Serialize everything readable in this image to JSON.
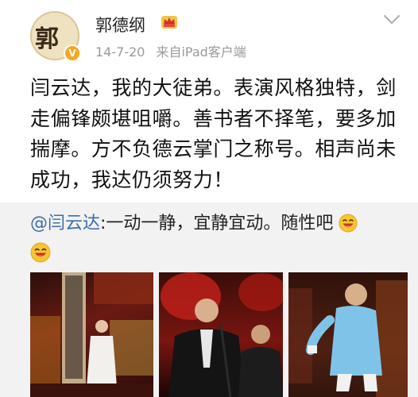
{
  "post": {
    "author": {
      "name": "郭德纲",
      "avatar_glyph": "郭",
      "verified_badge": "V"
    },
    "meta": {
      "date": "14-7-20",
      "source": "来自iPad客户端"
    },
    "text": "闫云达，我的大徒弟。表演风格独特，剑走偏锋颇堪咀嚼。善书者不择笔，要多加揣摩。方不负德云掌门之称号。相声尚未成功，我达仍须努力！"
  },
  "repost": {
    "mention": "@闫云达",
    "text": ":一动一静，宜静宜动。随性吧",
    "emoji": "laughing-face",
    "photos": [
      {
        "description_icon": "stage-performer-photo"
      },
      {
        "description_icon": "microphone-performers-photo"
      },
      {
        "description_icon": "gown-performer-photo"
      }
    ]
  },
  "colors": {
    "mention": "#3b6eab",
    "badge": "#f5a623",
    "repost_background": "#f2f2f2"
  }
}
